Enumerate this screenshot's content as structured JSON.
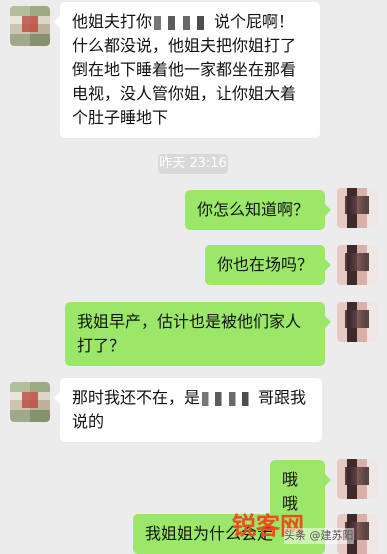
{
  "chat": {
    "timestamp": "昨天 23:16",
    "messages": [
      {
        "side": "left",
        "avatar": "contact-avatar",
        "text": "他姐夫打你[redacted]说个屁啊！什么都没说，他姐夫把你姐打了倒在地下睡着他一家都坐在那看电视，没人管你姐，让你姐大着个肚子睡地下"
      },
      {
        "side": "right",
        "avatar": "user-avatar",
        "text": "你怎么知道啊？"
      },
      {
        "side": "right",
        "avatar": "user-avatar",
        "text": "你也在场吗？"
      },
      {
        "side": "right",
        "avatar": "user-avatar",
        "text": "我姐早产，估计也是被他们家人打了？"
      },
      {
        "side": "left",
        "avatar": "contact-avatar",
        "text": "那时我还不在，是[redacted]哥跟我说的"
      },
      {
        "side": "right",
        "avatar": "user-avatar",
        "text": "哦哦"
      },
      {
        "side": "right",
        "avatar": "user-avatar",
        "text": "我姐姐为什么会走"
      }
    ],
    "msg1": {
      "part1": "他姐夫打你",
      "part2": "说个屁啊！",
      "rest": "什么都没说，他姐夫把你姐打了倒在地下睡着他一家都坐在那看电视，没人管你姐，让你姐大着个肚子睡地下"
    },
    "msg2": "你怎么知道啊？",
    "msg3": "你也在场吗？",
    "msg4": "我姐早产，估计也是被他们家人打了？",
    "msg5": {
      "part1": "那时我还不在，是",
      "part2": "哥跟",
      "rest": "我说的"
    },
    "msg6": "哦哦",
    "msg7": "我姐姐为什么会走"
  },
  "watermark": {
    "main": "锐客网",
    "sub": "头条 @建苏阳"
  }
}
